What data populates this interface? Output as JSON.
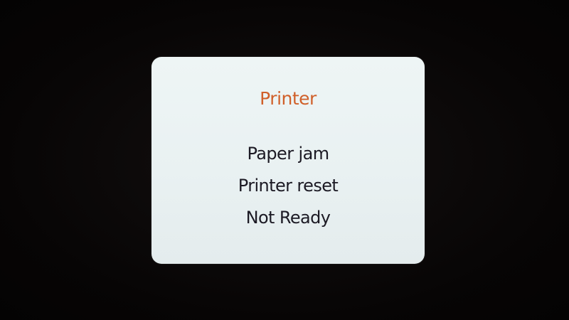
{
  "dialog": {
    "title": "Printer",
    "messages": [
      "Paper jam",
      "Printer reset",
      "Not Ready"
    ]
  },
  "colors": {
    "background": "#070505",
    "panel": "#eaf2f3",
    "title": "#d0602a",
    "text": "#1c1a24"
  }
}
